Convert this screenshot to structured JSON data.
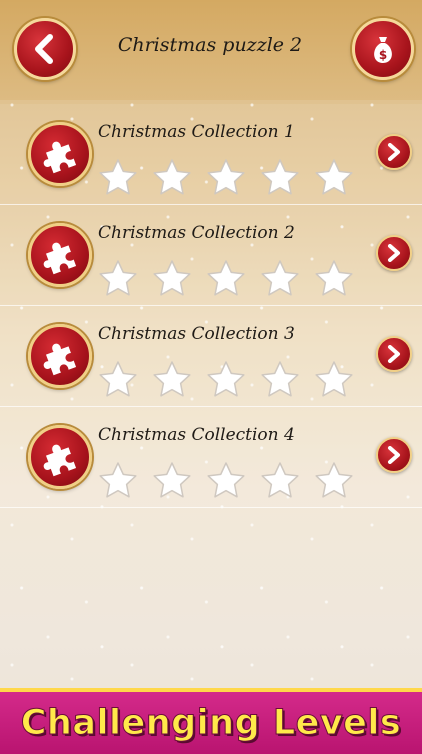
{
  "header": {
    "title": "Christmas puzzle 2",
    "back_icon": "chevron-left-icon",
    "bag_icon": "money-bag-icon"
  },
  "collections": [
    {
      "label": "Christmas Collection 1",
      "stars_filled": 0,
      "stars_total": 5
    },
    {
      "label": "Christmas Collection 2",
      "stars_filled": 0,
      "stars_total": 5
    },
    {
      "label": "Christmas Collection 3",
      "stars_filled": 0,
      "stars_total": 5
    },
    {
      "label": "Christmas Collection 4",
      "stars_filled": 0,
      "stars_total": 5
    }
  ],
  "banner": {
    "text": "Challenging Levels"
  },
  "colors": {
    "accent_red": "#a8141c",
    "gold": "#f0cf86",
    "banner_pink": "#c61c7e",
    "banner_text": "#ffe94a"
  }
}
